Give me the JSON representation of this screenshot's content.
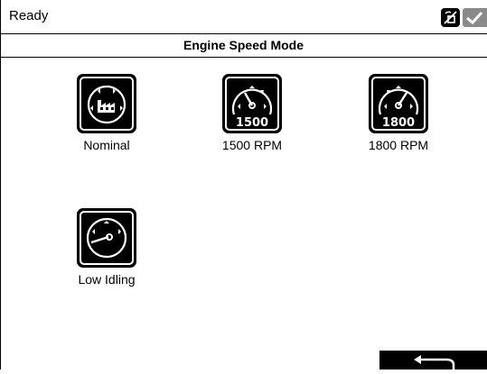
{
  "status": {
    "text": "Ready",
    "icons": [
      "no-signal-icon",
      "check-icon"
    ],
    "check_color": "#8a8a8a"
  },
  "title": "Engine Speed Mode",
  "modes": [
    {
      "label": "Nominal",
      "icon": "factory-gauge-icon"
    },
    {
      "label": "1500 RPM",
      "icon": "gauge-1500-icon",
      "gauge_text": "1500"
    },
    {
      "label": "1800 RPM",
      "icon": "gauge-1800-icon",
      "gauge_text": "1800"
    },
    {
      "label": "Low Idling",
      "icon": "gauge-low-idle-icon"
    }
  ],
  "back_button": {
    "icon": "back-arrow-icon"
  }
}
